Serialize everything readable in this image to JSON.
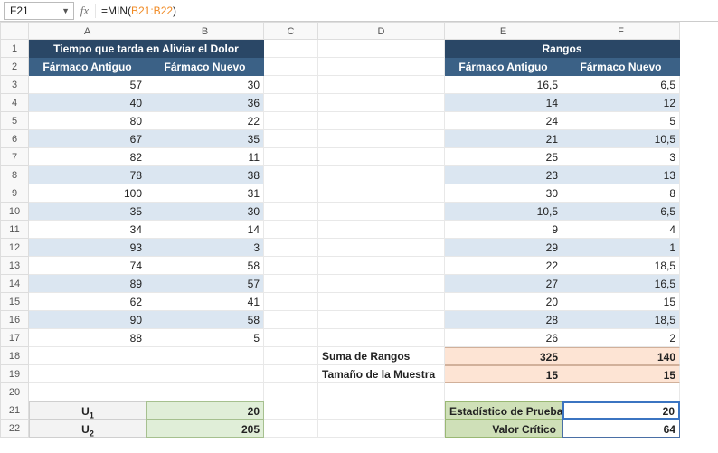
{
  "formula_bar": {
    "cell_ref": "F21",
    "fx_label": "fx",
    "formula_prefix": "=MIN(",
    "formula_ref": "B21:B22",
    "formula_suffix": ")"
  },
  "columns": [
    "A",
    "B",
    "C",
    "D",
    "E",
    "F"
  ],
  "rows": [
    "1",
    "2",
    "3",
    "4",
    "5",
    "6",
    "7",
    "8",
    "9",
    "10",
    "11",
    "12",
    "13",
    "14",
    "15",
    "16",
    "17",
    "18",
    "19",
    "20",
    "21",
    "22"
  ],
  "t1": {
    "title": "Tiempo que tarda en Aliviar el Dolor",
    "col1": "Fármaco Antiguo",
    "col2": "Fármaco Nuevo",
    "data": [
      {
        "a": "57",
        "b": "30"
      },
      {
        "a": "40",
        "b": "36"
      },
      {
        "a": "80",
        "b": "22"
      },
      {
        "a": "67",
        "b": "35"
      },
      {
        "a": "82",
        "b": "11"
      },
      {
        "a": "78",
        "b": "38"
      },
      {
        "a": "100",
        "b": "31"
      },
      {
        "a": "35",
        "b": "30"
      },
      {
        "a": "34",
        "b": "14"
      },
      {
        "a": "93",
        "b": "3"
      },
      {
        "a": "74",
        "b": "58"
      },
      {
        "a": "89",
        "b": "57"
      },
      {
        "a": "62",
        "b": "41"
      },
      {
        "a": "90",
        "b": "58"
      },
      {
        "a": "88",
        "b": "5"
      }
    ]
  },
  "t2": {
    "title": "Rangos",
    "col1": "Fármaco Antiguo",
    "col2": "Fármaco Nuevo",
    "data": [
      {
        "a": "16,5",
        "b": "6,5"
      },
      {
        "a": "14",
        "b": "12"
      },
      {
        "a": "24",
        "b": "5"
      },
      {
        "a": "21",
        "b": "10,5"
      },
      {
        "a": "25",
        "b": "3"
      },
      {
        "a": "23",
        "b": "13"
      },
      {
        "a": "30",
        "b": "8"
      },
      {
        "a": "10,5",
        "b": "6,5"
      },
      {
        "a": "9",
        "b": "4"
      },
      {
        "a": "29",
        "b": "1"
      },
      {
        "a": "22",
        "b": "18,5"
      },
      {
        "a": "27",
        "b": "16,5"
      },
      {
        "a": "20",
        "b": "15"
      },
      {
        "a": "28",
        "b": "18,5"
      },
      {
        "a": "26",
        "b": "2"
      }
    ]
  },
  "summary": {
    "suma_label": "Suma de Rangos",
    "suma_e": "325",
    "suma_f": "140",
    "tam_label": "Tamaño de la Muestra",
    "tam_e": "15",
    "tam_f": "15"
  },
  "u": {
    "u1_label": "U",
    "u1_sub": "1",
    "u1_val": "20",
    "u2_label": "U",
    "u2_sub": "2",
    "u2_val": "205"
  },
  "stats": {
    "test_label": "Estadístico de Prueba",
    "test_val": "20",
    "crit_label": "Valor Crítico",
    "crit_val": "64"
  }
}
